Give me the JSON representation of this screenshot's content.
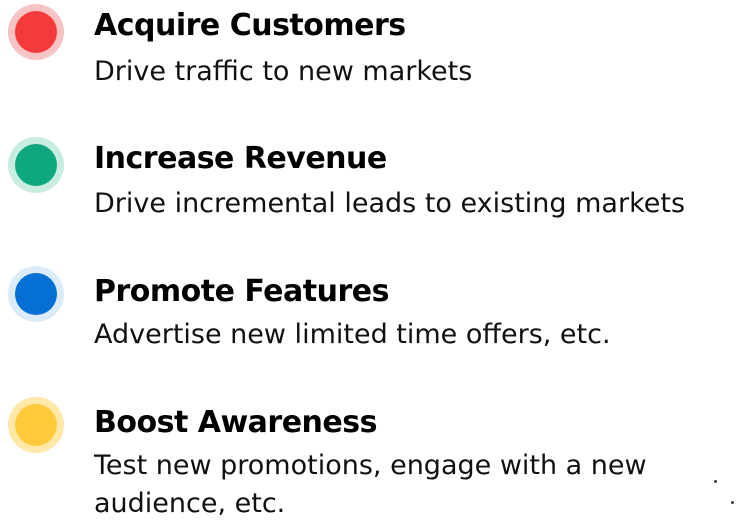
{
  "goals": [
    {
      "title": "Acquire Customers",
      "description": "Drive traffic to new markets",
      "icon": "red-circle-icon",
      "color": "#f33b3b",
      "halo": "#f7c4c4"
    },
    {
      "title": "Increase Revenue",
      "description": "Drive incremental leads to existing markets",
      "icon": "green-circle-icon",
      "color": "#0fa77e",
      "halo": "#c9ece1"
    },
    {
      "title": "Promote Features",
      "description": "Advertise new limited time offers, etc.",
      "icon": "blue-circle-icon",
      "color": "#066fd6",
      "halo": "#dcebf8"
    },
    {
      "title": "Boost Awareness",
      "description": "Test new promotions, engage with a new audience, etc.",
      "icon": "yellow-circle-icon",
      "color": "#ffca3a",
      "halo": "#ffe8a8"
    }
  ]
}
